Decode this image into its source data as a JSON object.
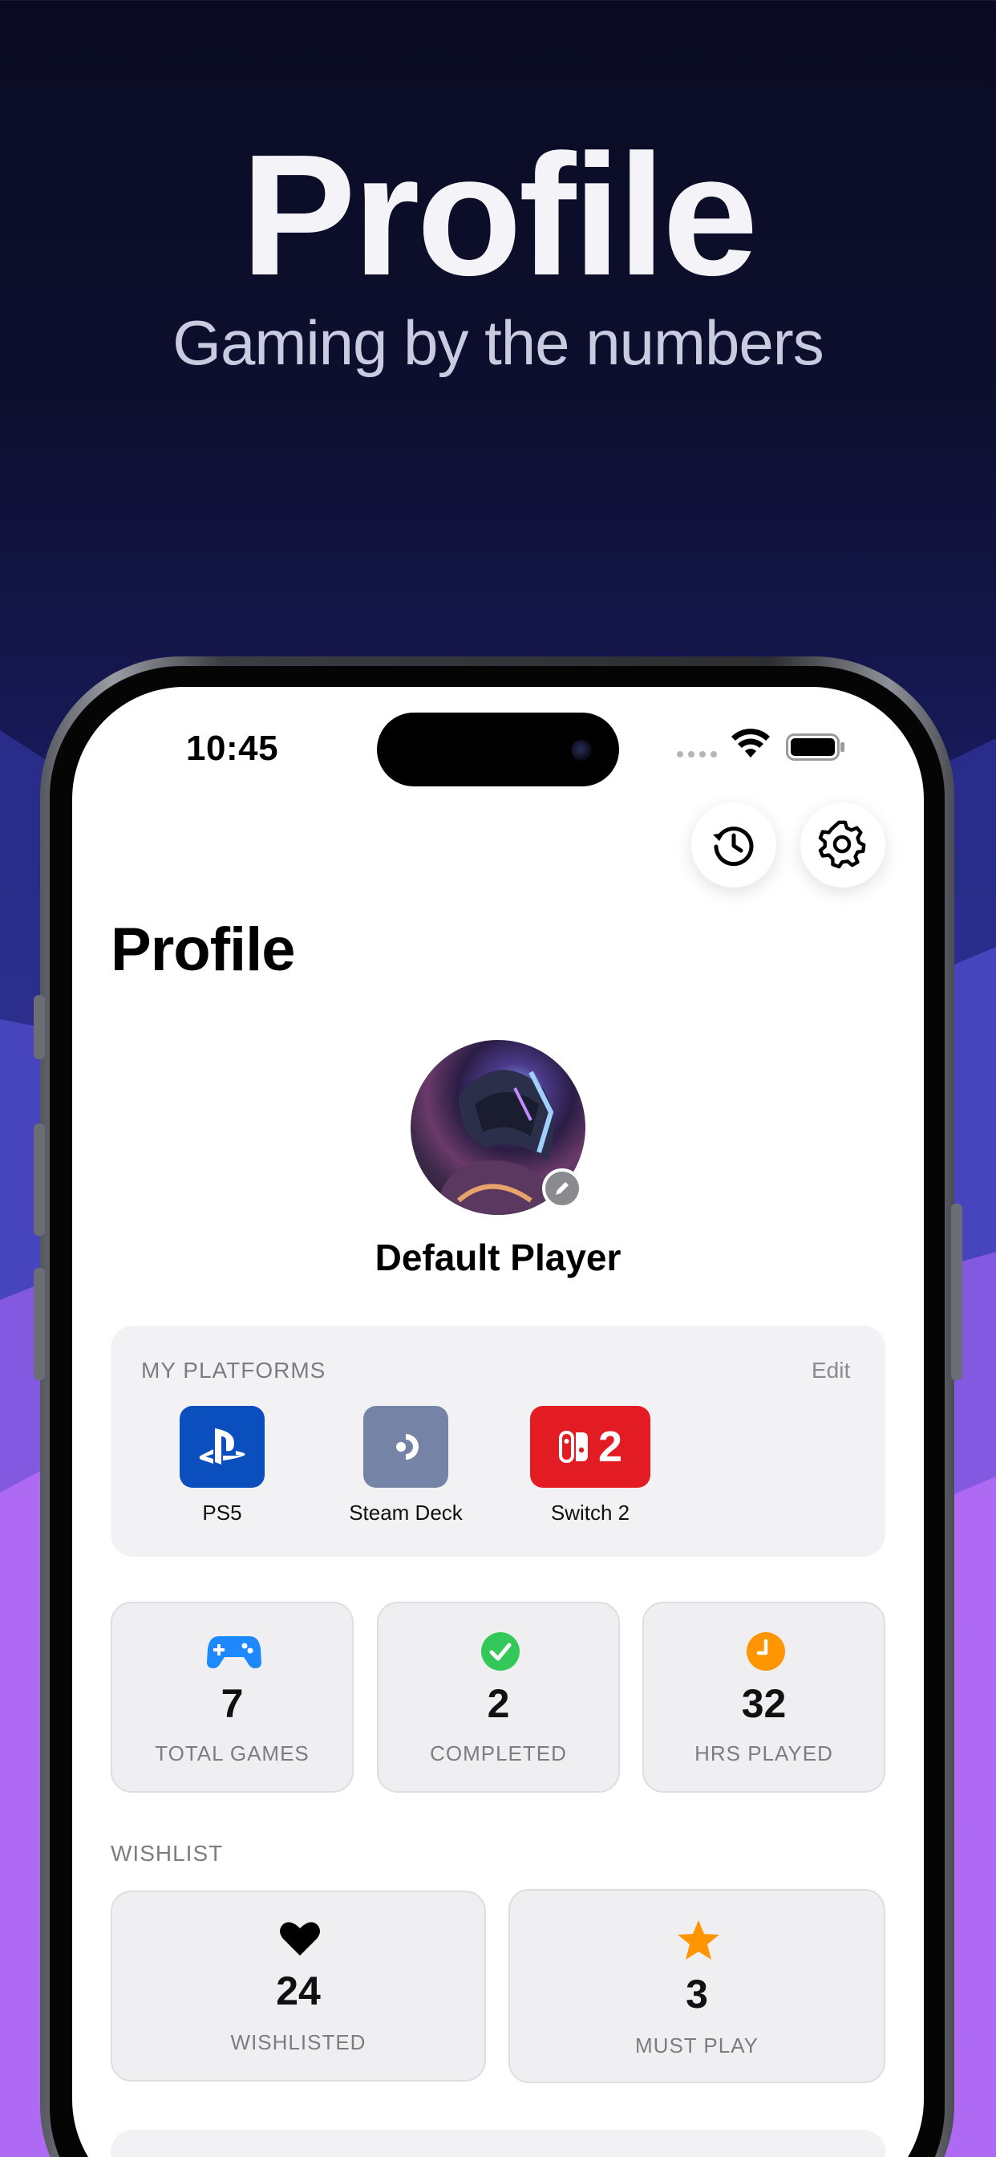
{
  "hero": {
    "title": "Profile",
    "subtitle": "Gaming by the numbers"
  },
  "status_bar": {
    "time": "10:45"
  },
  "screen": {
    "title": "Profile",
    "history_button_icon": "history-icon",
    "settings_button_icon": "gear-icon",
    "player": {
      "name": "Default Player",
      "avatar_icon": "avatar-image",
      "edit_icon": "pencil-icon"
    },
    "platforms": {
      "section_label": "MY PLATFORMS",
      "edit_label": "Edit",
      "items": [
        {
          "name": "PS5",
          "icon": "playstation-icon",
          "color": "#0b4fbf"
        },
        {
          "name": "Steam Deck",
          "icon": "steam-deck-icon",
          "color": "#7584a6"
        },
        {
          "name": "Switch 2",
          "icon": "switch-icon",
          "badge": "2",
          "color": "#e31b23"
        }
      ]
    },
    "stats": [
      {
        "value": "7",
        "label": "TOTAL GAMES",
        "icon": "gamepad-icon",
        "color": "#1e88ff"
      },
      {
        "value": "2",
        "label": "COMPLETED",
        "icon": "checkmark-circle-icon",
        "color": "#34c759"
      },
      {
        "value": "32",
        "label": "HRS PLAYED",
        "icon": "clock-icon",
        "color": "#ff9500"
      }
    ],
    "wishlist": {
      "section_label": "WISHLIST",
      "items": [
        {
          "value": "24",
          "label": "WISHLISTED",
          "icon": "heart-icon",
          "color": "#000000"
        },
        {
          "value": "3",
          "label": "MUST PLAY",
          "icon": "star-icon",
          "color": "#ff9500"
        }
      ]
    }
  }
}
